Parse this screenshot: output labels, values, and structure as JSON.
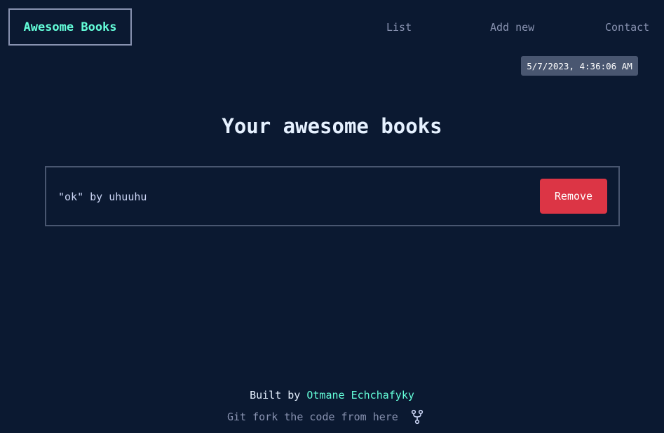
{
  "header": {
    "logo": "Awesome Books",
    "nav": {
      "list": "List",
      "add_new": "Add new",
      "contact": "Contact"
    },
    "datetime": "5/7/2023, 4:36:06 AM"
  },
  "main": {
    "title": "Your awesome books",
    "books": [
      {
        "text": "\"ok\" by uhuuhu",
        "remove_label": "Remove"
      }
    ]
  },
  "footer": {
    "built_by_prefix": "Built by",
    "author": "Otmane Echchafyky",
    "fork_text": "Git fork the code from here",
    "fork_icon": "git-fork-icon"
  },
  "colors": {
    "background": "#0b1931",
    "accent": "#64ffda",
    "muted": "#8892b0",
    "danger": "#dc3545"
  }
}
